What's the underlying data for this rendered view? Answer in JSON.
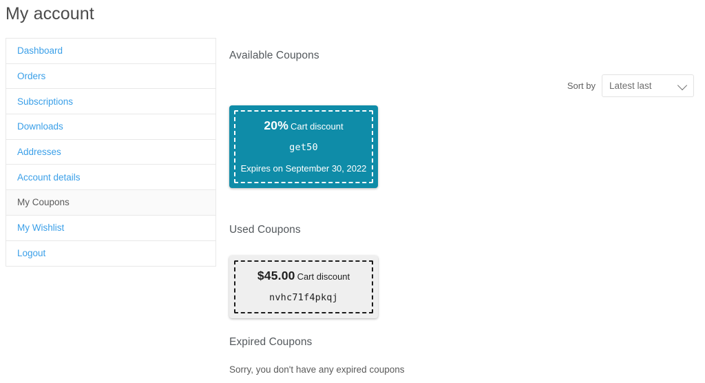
{
  "page": {
    "title": "My account"
  },
  "sidebar": {
    "items": [
      {
        "label": "Dashboard",
        "active": false
      },
      {
        "label": "Orders",
        "active": false
      },
      {
        "label": "Subscriptions",
        "active": false
      },
      {
        "label": "Downloads",
        "active": false
      },
      {
        "label": "Addresses",
        "active": false
      },
      {
        "label": "Account details",
        "active": false
      },
      {
        "label": "My Coupons",
        "active": true
      },
      {
        "label": "My Wishlist",
        "active": false
      },
      {
        "label": "Logout",
        "active": false
      }
    ]
  },
  "sort": {
    "label": "Sort by",
    "selected": "Latest last",
    "icon": "chevron-down-icon"
  },
  "sections": {
    "available": {
      "heading": "Available Coupons",
      "coupon": {
        "amount": "20%",
        "type": "Cart discount",
        "code": "get50",
        "expiry": "Expires on September 30, 2022"
      }
    },
    "used": {
      "heading": "Used Coupons",
      "coupon": {
        "amount": "$45.00",
        "type": "Cart discount",
        "code": "nvhc71f4pkqj"
      }
    },
    "expired": {
      "heading": "Expired Coupons",
      "empty_message": "Sorry, you don't have any expired coupons"
    }
  },
  "colors": {
    "available_coupon_bg": "#0f8ca8",
    "used_coupon_bg": "#efefef",
    "link": "#3a9fe8",
    "active_row_bg": "#fafafa"
  }
}
